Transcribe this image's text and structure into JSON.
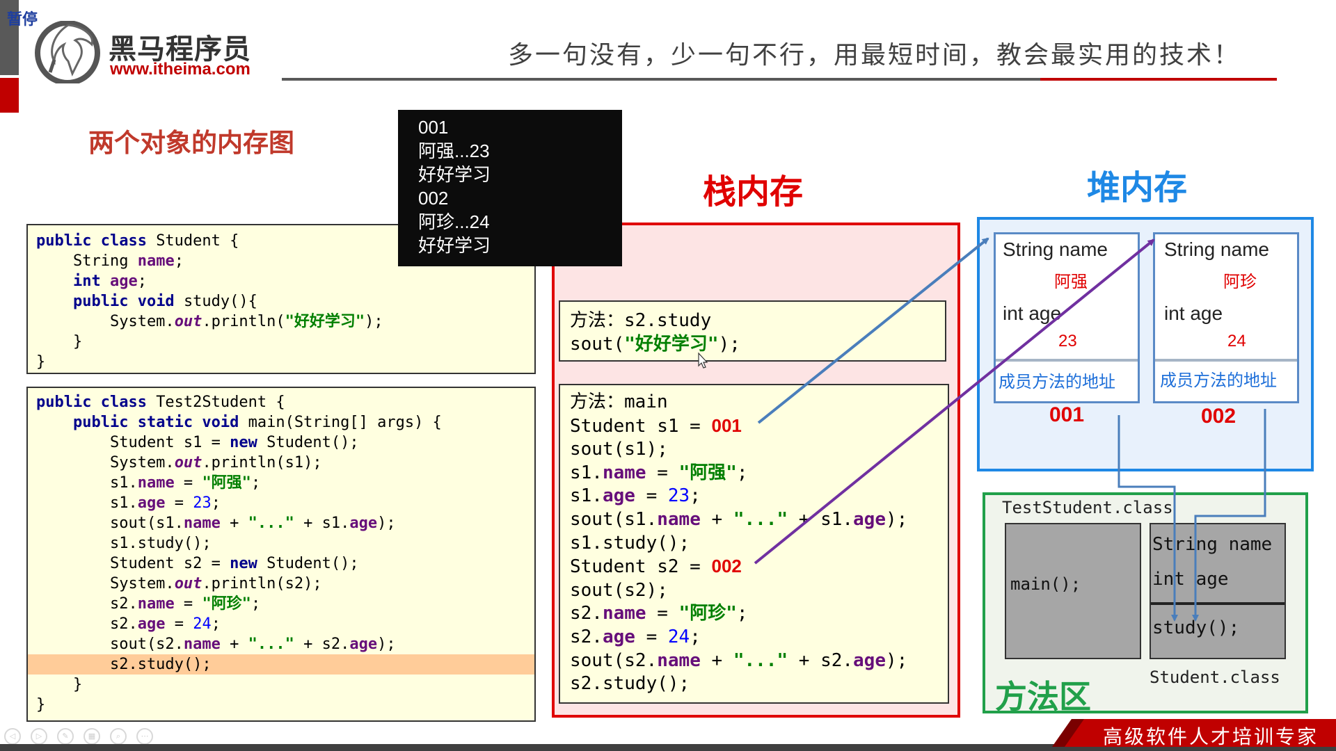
{
  "header": {
    "paused_label": "暂停",
    "logo_name": "黑马程序员",
    "logo_url": "www.itheima.com",
    "slogan": "多一句没有，少一句不行，用最短时间，教会最实用的技术！"
  },
  "slide_title": "两个对象的内存图",
  "console_output": [
    "001",
    "阿强...23",
    "好好学习",
    "002",
    "阿珍...24",
    "好好学习"
  ],
  "student_class": {
    "lines": [
      [
        [
          "public class ",
          "kw"
        ],
        [
          "Student {",
          ""
        ]
      ],
      [
        [
          "    String ",
          ""
        ],
        [
          "name",
          "fld"
        ],
        [
          ";",
          ""
        ]
      ],
      [
        [
          "    ",
          ""
        ],
        [
          "int ",
          "kw"
        ],
        [
          "age",
          "fld"
        ],
        [
          ";",
          ""
        ]
      ],
      [
        [
          "    ",
          ""
        ],
        [
          "public void ",
          "kw"
        ],
        [
          "study(){",
          ""
        ]
      ],
      [
        [
          "        System.",
          ""
        ],
        [
          "out",
          "it"
        ],
        [
          ".println(",
          ""
        ],
        [
          "\"好好学习\"",
          "str"
        ],
        [
          ");",
          ""
        ]
      ],
      [
        [
          "    }",
          ""
        ]
      ],
      [
        [
          "}",
          ""
        ]
      ]
    ]
  },
  "test_class": {
    "highlight_line": 13,
    "lines": [
      [
        [
          "public class ",
          "kw"
        ],
        [
          "Test2Student {",
          ""
        ]
      ],
      [
        [
          "    ",
          ""
        ],
        [
          "public static void ",
          "kw"
        ],
        [
          "main(String[] args) {",
          ""
        ]
      ],
      [
        [
          "        Student s1 = ",
          ""
        ],
        [
          "new ",
          "kw"
        ],
        [
          "Student();",
          ""
        ]
      ],
      [
        [
          "        System.",
          ""
        ],
        [
          "out",
          "it"
        ],
        [
          ".println(s1);",
          ""
        ]
      ],
      [
        [
          "        s1.",
          ""
        ],
        [
          "name",
          "fld"
        ],
        [
          " = ",
          ""
        ],
        [
          "\"阿强\"",
          "str"
        ],
        [
          ";",
          ""
        ]
      ],
      [
        [
          "        s1.",
          ""
        ],
        [
          "age",
          "fld"
        ],
        [
          " = ",
          ""
        ],
        [
          "23",
          "num"
        ],
        [
          ";",
          ""
        ]
      ],
      [
        [
          "        sout(s1.",
          ""
        ],
        [
          "name",
          "fld"
        ],
        [
          " + ",
          ""
        ],
        [
          "\"...\"",
          "str"
        ],
        [
          " + s1.",
          ""
        ],
        [
          "age",
          "fld"
        ],
        [
          ");",
          ""
        ]
      ],
      [
        [
          "        s1.study();",
          ""
        ]
      ],
      [
        [
          "        Student s2 = ",
          ""
        ],
        [
          "new ",
          "kw"
        ],
        [
          "Student();",
          ""
        ]
      ],
      [
        [
          "        System.",
          ""
        ],
        [
          "out",
          "it"
        ],
        [
          ".println(s2);",
          ""
        ]
      ],
      [
        [
          "        s2.",
          ""
        ],
        [
          "name",
          "fld"
        ],
        [
          " = ",
          ""
        ],
        [
          "\"阿珍\"",
          "str"
        ],
        [
          ";",
          ""
        ]
      ],
      [
        [
          "        s2.",
          ""
        ],
        [
          "age",
          "fld"
        ],
        [
          " = ",
          ""
        ],
        [
          "24",
          "num"
        ],
        [
          ";",
          ""
        ]
      ],
      [
        [
          "        sout(s2.",
          ""
        ],
        [
          "name",
          "fld"
        ],
        [
          " + ",
          ""
        ],
        [
          "\"...\"",
          "str"
        ],
        [
          " + s2.",
          ""
        ],
        [
          "age",
          "fld"
        ],
        [
          ");",
          ""
        ]
      ],
      [
        [
          "        s2.study();",
          ""
        ]
      ],
      [
        [
          "    }",
          ""
        ]
      ],
      [
        [
          "}",
          ""
        ]
      ]
    ]
  },
  "stack": {
    "title": "栈内存",
    "study_frame": {
      "lines": [
        [
          [
            "方法：s2.study",
            ""
          ]
        ],
        [
          [
            "sout(",
            ""
          ],
          [
            "\"好好学习\"",
            "str"
          ],
          [
            ");",
            ""
          ]
        ]
      ]
    },
    "main_frame": {
      "lines": [
        [
          [
            "方法：main",
            ""
          ]
        ],
        [
          [
            "Student s1 = ",
            ""
          ],
          [
            "001",
            "addr"
          ]
        ],
        [
          [
            "sout(s1);",
            ""
          ]
        ],
        [
          [
            "s1.",
            ""
          ],
          [
            "name",
            "fld"
          ],
          [
            " = ",
            ""
          ],
          [
            "\"阿强\"",
            "str"
          ],
          [
            ";",
            ""
          ]
        ],
        [
          [
            "s1.",
            ""
          ],
          [
            "age",
            "fld"
          ],
          [
            " = ",
            ""
          ],
          [
            "23",
            "num"
          ],
          [
            ";",
            ""
          ]
        ],
        [
          [
            "sout(s1.",
            ""
          ],
          [
            "name",
            "fld"
          ],
          [
            " + ",
            ""
          ],
          [
            "\"...\"",
            "str"
          ],
          [
            " + s1.",
            ""
          ],
          [
            "age",
            "fld"
          ],
          [
            ");",
            ""
          ]
        ],
        [
          [
            "s1.study();",
            ""
          ]
        ],
        [
          [
            "Student s2 = ",
            ""
          ],
          [
            "002",
            "addr"
          ]
        ],
        [
          [
            "sout(s2);",
            ""
          ]
        ],
        [
          [
            "s2.",
            ""
          ],
          [
            "name",
            "fld"
          ],
          [
            " = ",
            ""
          ],
          [
            "\"阿珍\"",
            "str"
          ],
          [
            ";",
            ""
          ]
        ],
        [
          [
            "s2.",
            ""
          ],
          [
            "age",
            "fld"
          ],
          [
            " = ",
            ""
          ],
          [
            "24",
            "num"
          ],
          [
            ";",
            ""
          ]
        ],
        [
          [
            "sout(s2.",
            ""
          ],
          [
            "name",
            "fld"
          ],
          [
            " + ",
            ""
          ],
          [
            "\"...\"",
            "str"
          ],
          [
            " + s2.",
            ""
          ],
          [
            "age",
            "fld"
          ],
          [
            ");",
            ""
          ]
        ],
        [
          [
            "s2.study();",
            ""
          ]
        ]
      ]
    }
  },
  "heap": {
    "title": "堆内存",
    "objects": [
      {
        "name_label": "String name",
        "name_value": "阿强",
        "age_label": "int age",
        "age_value": "23",
        "method_addr": "成员方法的地址",
        "address": "001"
      },
      {
        "name_label": "String name",
        "name_value": "阿珍",
        "age_label": "int age",
        "age_value": "24",
        "method_addr": "成员方法的地址",
        "address": "002"
      }
    ]
  },
  "method_area": {
    "title": "方法区",
    "test_class_label": "TestStudent.class",
    "main_method": "main();",
    "student_fields": [
      "String name",
      "int age"
    ],
    "student_method": "study();",
    "student_class_label": "Student.class"
  },
  "footer": {
    "tagline": "高级软件人才培训专家"
  },
  "colors": {
    "brand_red": "#c00000",
    "stack_red": "#e00000",
    "heap_blue": "#1e88e5",
    "method_green": "#21a04a",
    "arrow_blue": "#4a7ebb",
    "arrow_purple": "#7030a0"
  }
}
